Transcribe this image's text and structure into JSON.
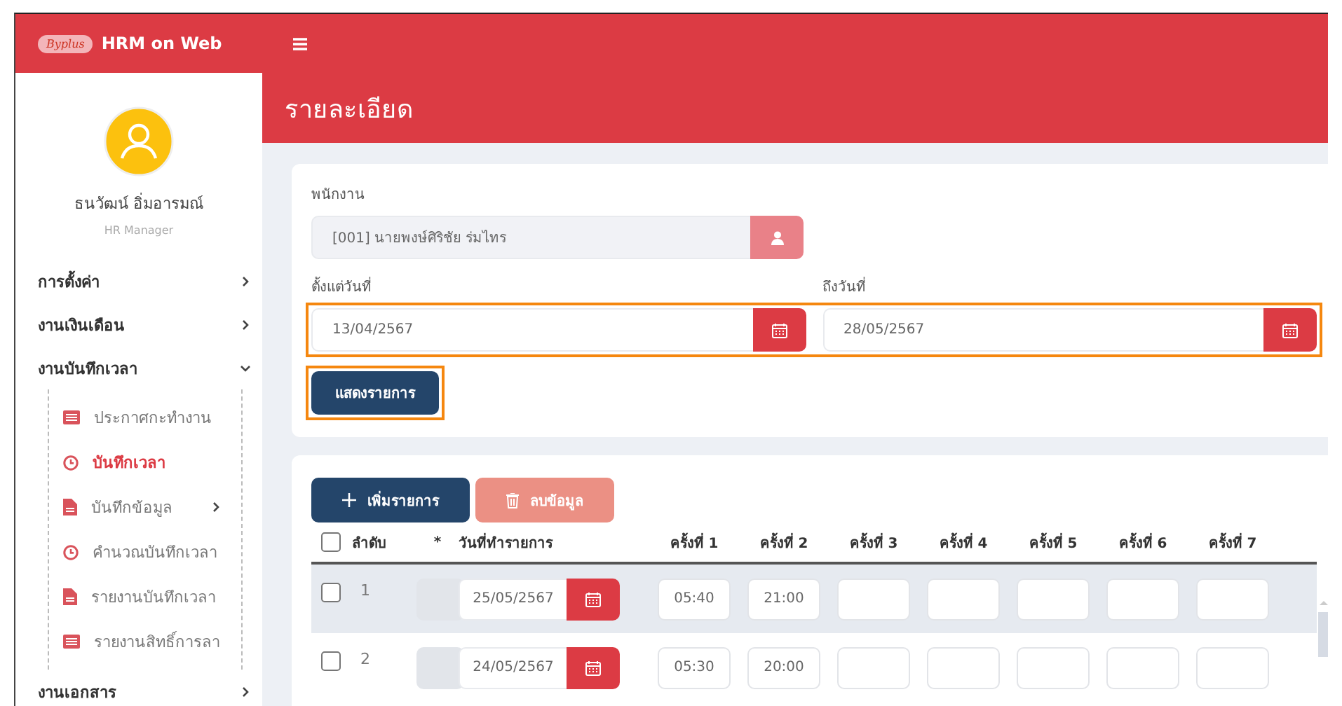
{
  "app": {
    "title": "HRM on Web",
    "logo": "Byplus"
  },
  "user": {
    "name": "ธนวัฒน์ อิ่มอารมณ์",
    "role": "HR Manager"
  },
  "menu": [
    {
      "label": "การตั้งค่า",
      "expanded": false
    },
    {
      "label": "งานเงินเดือน",
      "expanded": false
    },
    {
      "label": "งานบันทึกเวลา",
      "expanded": true,
      "children": [
        {
          "label": "ประกาศกะทำงาน",
          "kind": "list",
          "selected": false
        },
        {
          "label": "บันทึกเวลา",
          "kind": "clock",
          "selected": true
        },
        {
          "label": "บันทึกข้อมูล",
          "kind": "file",
          "selected": false,
          "expanded": false
        },
        {
          "label": "คำนวณบันทึกเวลา",
          "kind": "clock",
          "selected": false
        },
        {
          "label": "รายงานบันทึกเวลา",
          "kind": "file",
          "selected": false
        },
        {
          "label": "รายงานสิทธิ์การลา",
          "kind": "list",
          "selected": false
        }
      ]
    },
    {
      "label": "งานเอกสาร",
      "expanded": false
    }
  ],
  "page_title": "รายละเอียด",
  "filter": {
    "employee_label": "พนักงาน",
    "employee": "[001] นายพงษ์ศิริชัย ร่มไทร",
    "from_label": "ตั้งแต่วันที่",
    "from": "13/04/2567",
    "to_label": "ถึงวันที่",
    "to": "28/05/2567",
    "show_button": "แสดงรายการ"
  },
  "actions": {
    "add": "เพิ่มรายการ",
    "delete": "ลบข้อมูล"
  },
  "table": {
    "select_all_checked": false,
    "columns": [
      "ลำดับ",
      "*",
      "วันที่ทำรายการ",
      "ครั้งที่ 1",
      "ครั้งที่ 2",
      "ครั้งที่ 3",
      "ครั้งที่ 4",
      "ครั้งที่ 5",
      "ครั้งที่ 6",
      "ครั้งที่ 7"
    ],
    "rows": [
      {
        "checked": false,
        "highlighted": true,
        "no": "1",
        "date": "25/05/2567",
        "times": [
          "05:40",
          "21:00"
        ]
      },
      {
        "checked": false,
        "highlighted": false,
        "no": "2",
        "date": "24/05/2567",
        "times": [
          "05:30",
          "20:00"
        ]
      }
    ]
  }
}
